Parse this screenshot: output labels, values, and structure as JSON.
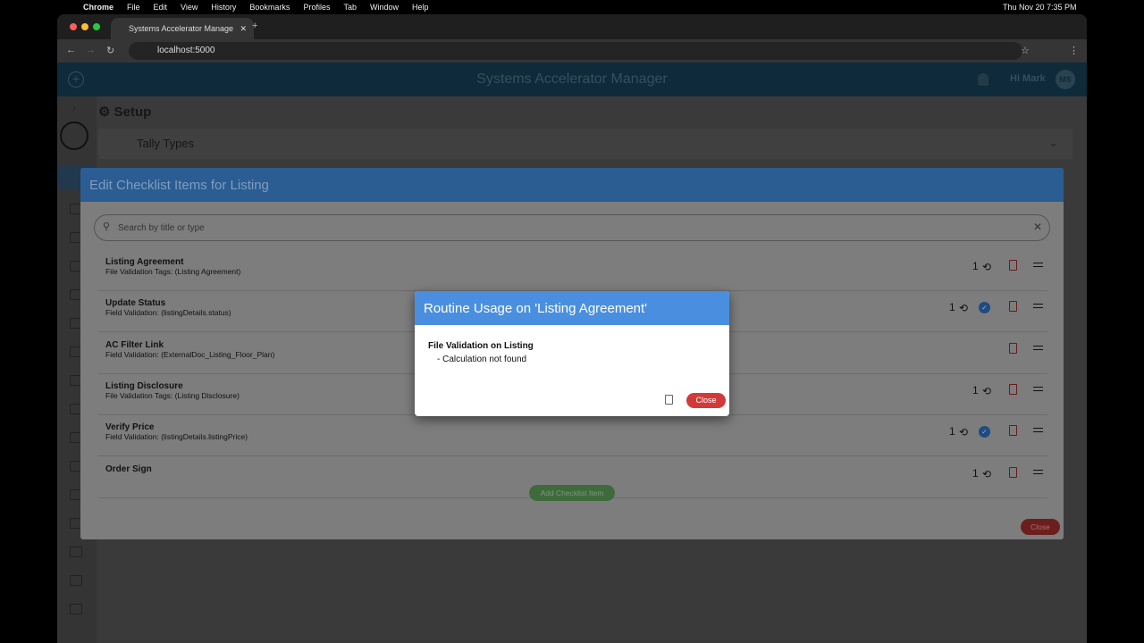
{
  "menubar": {
    "app": "Chrome",
    "items": [
      "File",
      "Edit",
      "View",
      "History",
      "Bookmarks",
      "Profiles",
      "Tab",
      "Window",
      "Help"
    ],
    "clock": "Thu Nov 20  7:35 PM"
  },
  "browser": {
    "tab_title": "Systems Accelerator Manage",
    "url": "localhost:5000"
  },
  "app": {
    "title": "Systems Accelerator Manager",
    "greeting": "Hi Mark",
    "avatar": "MS",
    "page_title": "Setup",
    "section": "Tally Types"
  },
  "dialog": {
    "title": "Edit Checklist Items for Listing",
    "search_placeholder": "Search by title or type",
    "add_label": "Add Checklist Item",
    "close_label": "Close",
    "items": [
      {
        "title": "Listing Agreement",
        "subtitle": "File Validation Tags: (Listing Agreement)",
        "count": "1",
        "verified": false
      },
      {
        "title": "Update Status",
        "subtitle": "Field Validation: (listingDetails.status)",
        "count": "1",
        "verified": true
      },
      {
        "title": "AC Filter Link",
        "subtitle": "Field Validation: (ExternalDoc_Listing_Floor_Plan)",
        "count": "",
        "verified": false
      },
      {
        "title": "Listing Disclosure",
        "subtitle": "File Validation Tags: (Listing Disclosure)",
        "count": "1",
        "verified": false
      },
      {
        "title": "Verify Price",
        "subtitle": "Field Validation: (listingDetails.listingPrice)",
        "count": "1",
        "verified": true
      },
      {
        "title": "Order Sign",
        "subtitle": "",
        "count": "1",
        "verified": false
      }
    ]
  },
  "popup": {
    "title": "Routine Usage on 'Listing Agreement'",
    "section": "File Validation on Listing",
    "item": "- Calculation not found",
    "close_label": "Close"
  },
  "colors": {
    "popup_header": "#4a8fdf",
    "close_button": "#d23a3a",
    "add_button": "#4caf50"
  }
}
